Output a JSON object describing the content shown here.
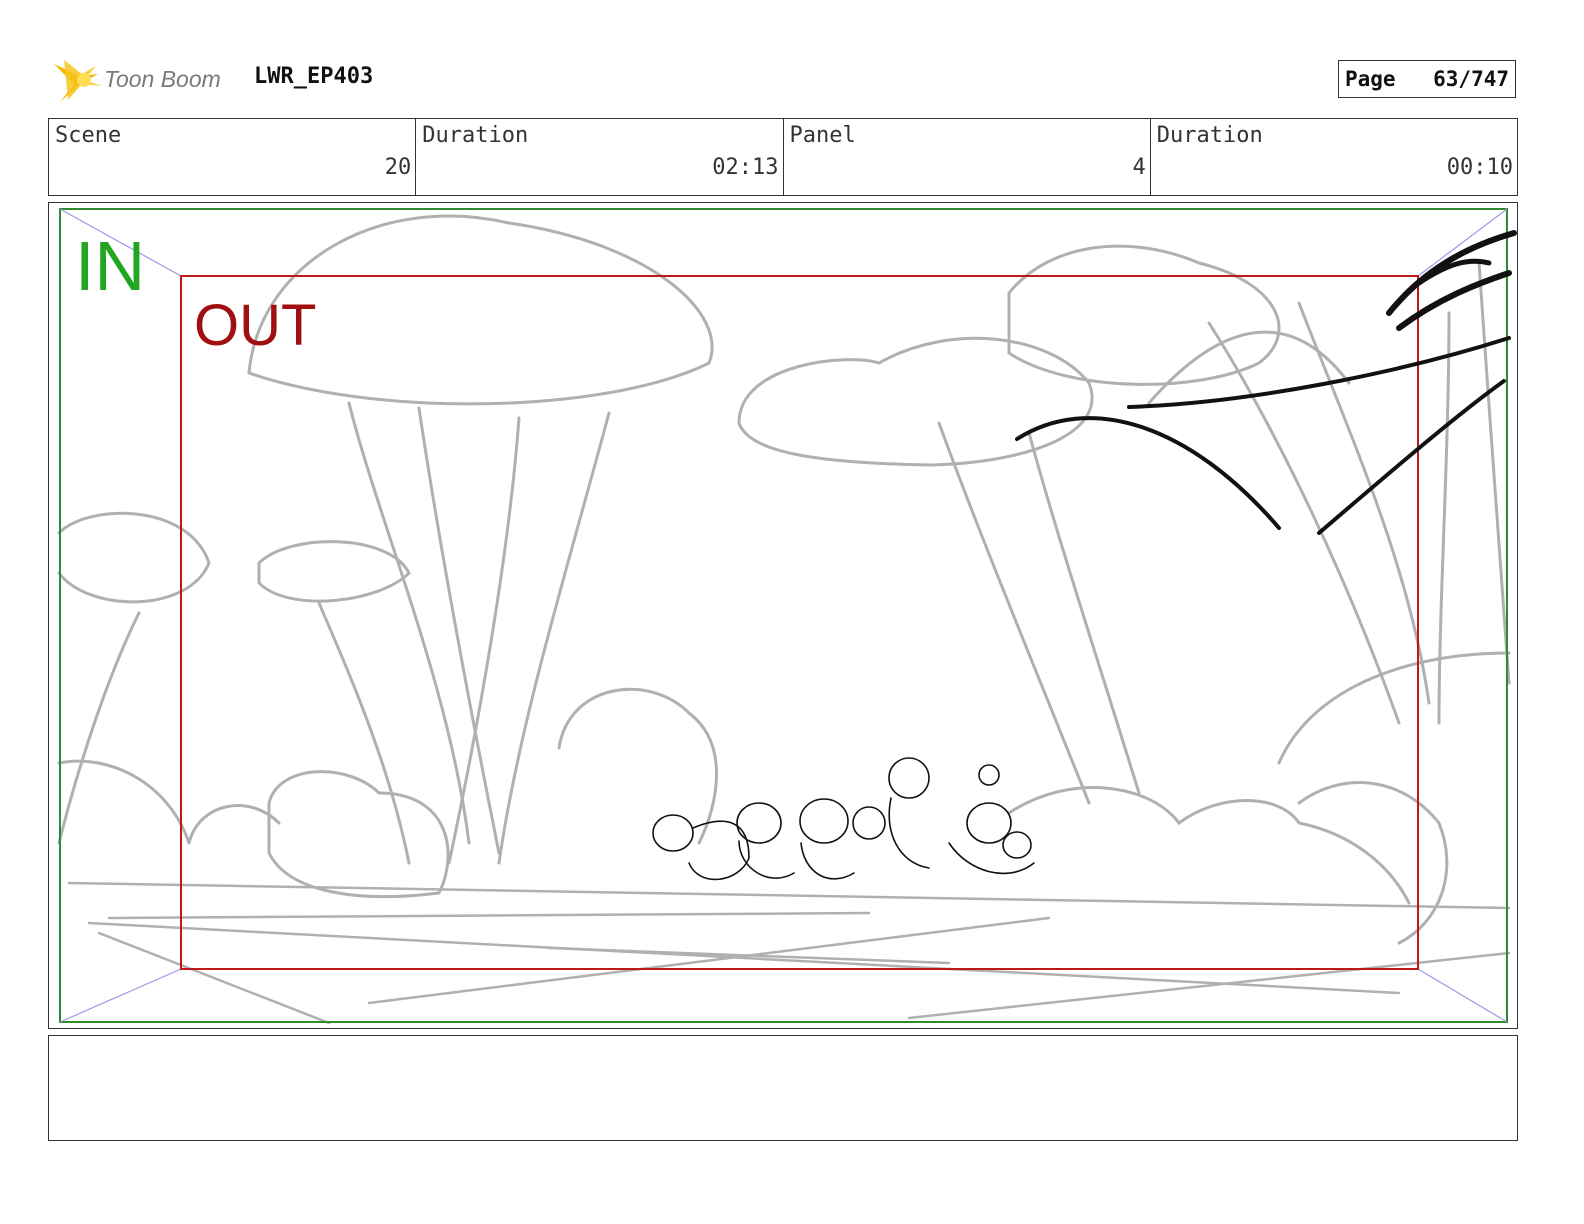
{
  "header": {
    "logo_text": "Toon Boom",
    "project": "LWR_EP403",
    "page_label": "Page",
    "page_value": "63/747"
  },
  "info": {
    "scene_label": "Scene",
    "scene_value": "20",
    "scene_duration_label": "Duration",
    "scene_duration_value": "02:13",
    "panel_label": "Panel",
    "panel_value": "4",
    "panel_duration_label": "Duration",
    "panel_duration_value": "00:10"
  },
  "frame": {
    "in_label": "IN",
    "out_label": "OUT"
  },
  "colors": {
    "in_frame": "#2e8b2e",
    "out_frame": "#c01818",
    "sketch": "#b0b0b0",
    "ink": "#111111"
  }
}
